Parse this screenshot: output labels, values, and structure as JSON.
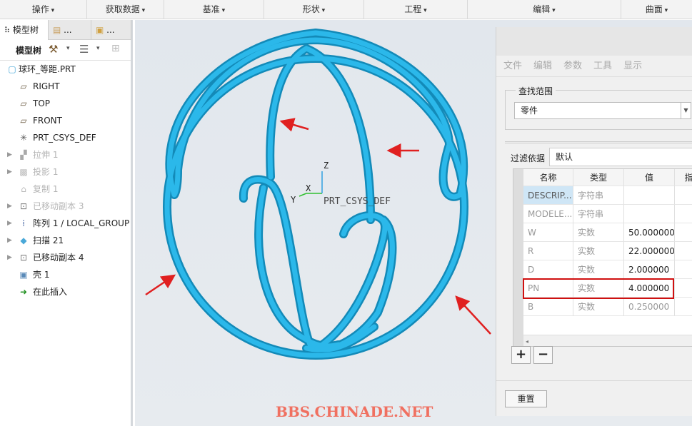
{
  "menubar": {
    "items": [
      "操作",
      "获取数据",
      "基准",
      "形状",
      "工程",
      "编辑",
      "曲面"
    ]
  },
  "left_panel": {
    "tabs": [
      {
        "label": "模型树",
        "icon": "tree-icon"
      },
      {
        "label": "...",
        "icon": "layers-icon"
      },
      {
        "label": "...",
        "icon": "folder-star-icon"
      }
    ],
    "toolbar_label": "模型树",
    "tree": [
      {
        "label": "球环_等距.PRT",
        "icon": "part-icon",
        "expand": false,
        "dim": false
      },
      {
        "label": "RIGHT",
        "icon": "plane-icon",
        "expand": false,
        "dim": false
      },
      {
        "label": "TOP",
        "icon": "plane-icon",
        "expand": false,
        "dim": false
      },
      {
        "label": "FRONT",
        "icon": "plane-icon",
        "expand": false,
        "dim": false
      },
      {
        "label": "PRT_CSYS_DEF",
        "icon": "csys-icon",
        "expand": false,
        "dim": false
      },
      {
        "label": "拉伸 1",
        "icon": "extrude-icon",
        "expand": true,
        "dim": true
      },
      {
        "label": "投影 1",
        "icon": "projection-icon",
        "expand": true,
        "dim": true
      },
      {
        "label": "复制 1",
        "icon": "copy-icon",
        "expand": false,
        "dim": true
      },
      {
        "label": "已移动副本 3",
        "icon": "moved-copy-icon",
        "expand": true,
        "dim": true
      },
      {
        "label": "阵列 1 / LOCAL_GROUP",
        "icon": "pattern-icon",
        "expand": true,
        "dim": false
      },
      {
        "label": "扫描 21",
        "icon": "sweep-icon",
        "expand": true,
        "dim": false
      },
      {
        "label": "已移动副本 4",
        "icon": "moved-copy-icon",
        "expand": true,
        "dim": false
      },
      {
        "label": "壳 1",
        "icon": "shell-icon",
        "expand": false,
        "dim": false
      },
      {
        "label": "在此插入",
        "icon": "insert-arrow-icon",
        "expand": false,
        "dim": false
      }
    ]
  },
  "viewport": {
    "csys_label": "PRT_CSYS_DEF",
    "axes": {
      "x": "X",
      "y": "Y",
      "z": "Z"
    },
    "watermark": "BBS.CHINADE.NET",
    "model_color": "#1aa6dc",
    "arrow_color": "#e02020"
  },
  "dialog": {
    "menu": [
      "文件",
      "编辑",
      "参数",
      "工具",
      "显示"
    ],
    "scope_label": "查找范围",
    "scope_value": "零件",
    "filter_label": "过滤依据",
    "filter_value": "默认",
    "columns": [
      "名称",
      "类型",
      "值",
      "指"
    ],
    "rows": [
      {
        "name": "DESCRIP...",
        "type": "字符串",
        "value": ""
      },
      {
        "name": "MODELE...",
        "type": "字符串",
        "value": ""
      },
      {
        "name": "W",
        "type": "实数",
        "value": "50.000000"
      },
      {
        "name": "R",
        "type": "实数",
        "value": "22.000000"
      },
      {
        "name": "D",
        "type": "实数",
        "value": "2.000000"
      },
      {
        "name": "PN",
        "type": "实数",
        "value": "4.000000"
      },
      {
        "name": "B",
        "type": "实数",
        "value": "0.250000"
      }
    ],
    "highlight_row": "PN",
    "highlight_color": "#d01010",
    "add_label": "+",
    "remove_label": "−",
    "reset_label": "重置"
  }
}
